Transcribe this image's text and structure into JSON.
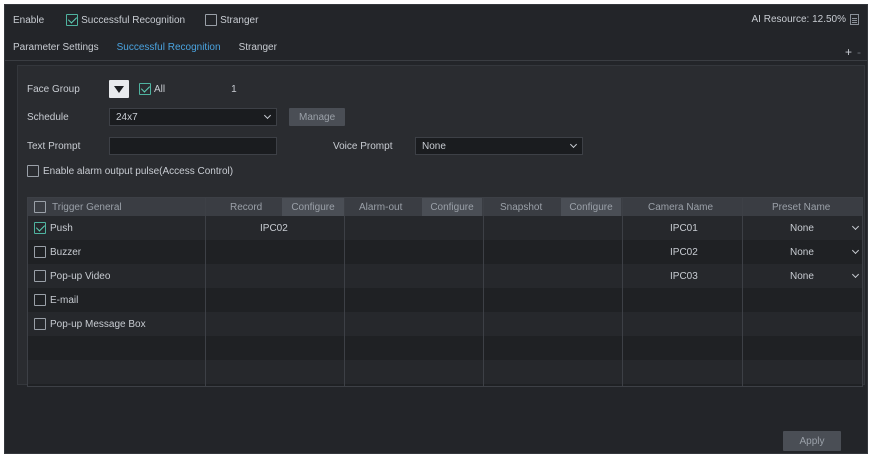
{
  "topbar": {
    "enable_label": "Enable",
    "options": [
      {
        "label": "Successful Recognition",
        "checked": true
      },
      {
        "label": "Stranger",
        "checked": false
      }
    ],
    "ai_resource": "AI Resource: 12.50%"
  },
  "tabs": [
    {
      "label": "Parameter Settings",
      "active": false
    },
    {
      "label": "Successful Recognition",
      "active": true
    },
    {
      "label": "Stranger",
      "active": false
    }
  ],
  "tab_actions": {
    "add": "+",
    "remove": "-"
  },
  "form": {
    "face_group_label": "Face Group",
    "all_label": "All",
    "face_group_count": "1",
    "schedule_label": "Schedule",
    "schedule_value": "24x7",
    "manage_label": "Manage",
    "text_prompt_label": "Text Prompt",
    "text_prompt_value": "",
    "voice_prompt_label": "Voice Prompt",
    "voice_prompt_value": "None",
    "alarm_pulse_label": "Enable alarm output pulse(Access Control)"
  },
  "grid": {
    "trigger_header": "Trigger General",
    "record_header": "Record",
    "alarm_header": "Alarm-out",
    "snapshot_header": "Snapshot",
    "configure_label": "Configure",
    "camera_header": "Camera Name",
    "preset_header": "Preset Name",
    "triggers": [
      {
        "label": "Push",
        "checked": true
      },
      {
        "label": "Buzzer",
        "checked": false
      },
      {
        "label": "Pop-up Video",
        "checked": false
      },
      {
        "label": "E-mail",
        "checked": false
      },
      {
        "label": "Pop-up Message Box",
        "checked": false
      }
    ],
    "record_values": [
      "IPC02"
    ],
    "cameras": [
      {
        "name": "IPC01",
        "preset": "None"
      },
      {
        "name": "IPC02",
        "preset": "None"
      },
      {
        "name": "IPC03",
        "preset": "None"
      }
    ]
  },
  "apply_label": "Apply"
}
